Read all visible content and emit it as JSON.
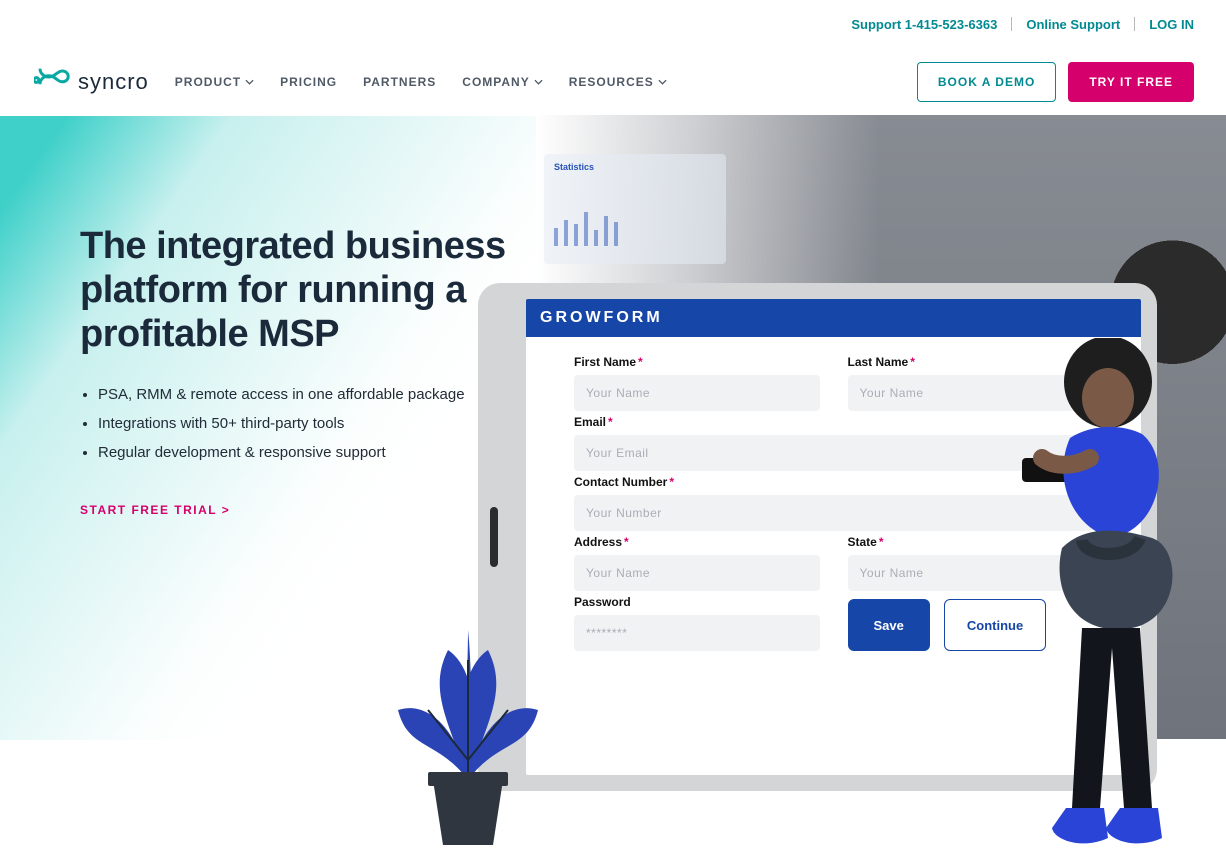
{
  "topbar": {
    "support_phone": "Support 1-415-523-6363",
    "online_support": "Online Support",
    "login": "LOG IN"
  },
  "header": {
    "brand": "syncro",
    "nav": [
      {
        "label": "PRODUCT",
        "has_menu": true
      },
      {
        "label": "PRICING",
        "has_menu": false
      },
      {
        "label": "PARTNERS",
        "has_menu": false
      },
      {
        "label": "COMPANY",
        "has_menu": true
      },
      {
        "label": "RESOURCES",
        "has_menu": true
      }
    ],
    "book_demo": "BOOK A DEMO",
    "try_free": "TRY IT FREE"
  },
  "hero": {
    "title": "The integrated business platform for running a profitable MSP",
    "bullets": [
      "PSA, RMM & remote access in one affordable package",
      "Integrations with 50+ third-party tools",
      "Regular development & responsive support"
    ],
    "cta": "START FREE TRIAL >"
  },
  "stats_overlay": {
    "title": "Statistics"
  },
  "form": {
    "title": "GROWFORM",
    "first_name_label": "First Name",
    "last_name_label": "Last Name",
    "email_label": "Email",
    "contact_label": "Contact  Number",
    "address_label": "Address",
    "state_label": "State",
    "password_label": "Password",
    "placeholders": {
      "name": "Your Name",
      "email": "Your Email",
      "number": "Your Number",
      "password": "********"
    },
    "save": "Save",
    "continue": "Continue"
  }
}
